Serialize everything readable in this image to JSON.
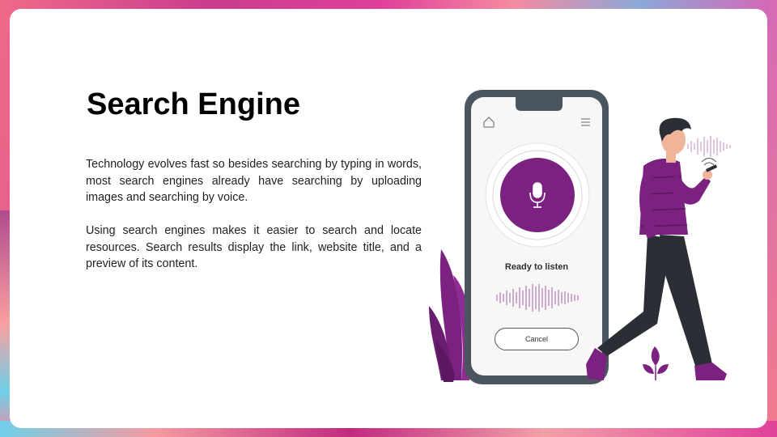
{
  "slide": {
    "title": "Search Engine",
    "paragraphs": [
      "Technology evolves fast so besides searching by typing in words, most search engines already have searching by uploading images and searching by voice.",
      "Using search engines makes it easier to search and locate resources. Search results display the link, website title, and a preview of its content."
    ]
  },
  "phone": {
    "status_text": "Ready to listen",
    "cancel_label": "Cancel",
    "icons": [
      "home-icon",
      "menu-icon",
      "microphone-icon",
      "sound-wave-icon"
    ]
  },
  "colors": {
    "accent": "#7b2280",
    "phone_frame": "#4a5560",
    "figure_pants": "#2b2e35",
    "skin": "#f0b49a"
  }
}
